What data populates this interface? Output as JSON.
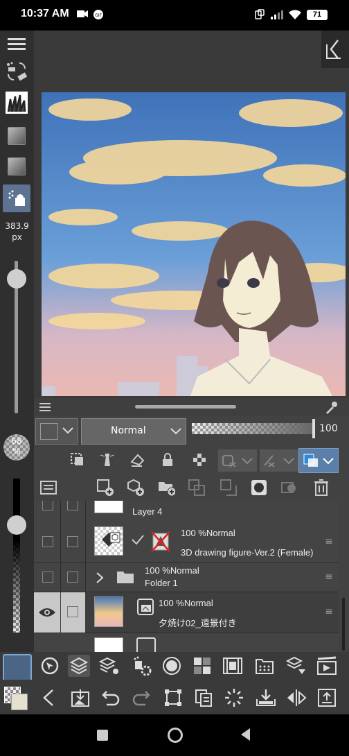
{
  "status_bar": {
    "time": "10:37 AM",
    "battery": "71"
  },
  "left_toolbar": {
    "brush_size_value": "383.9",
    "brush_size_unit": "px",
    "opacity_value": "68",
    "opacity_unit": "%",
    "brush_size_level": 0.12,
    "opacity_level": 0.3
  },
  "palette": {
    "blend_mode": "Normal",
    "opacity_value": "100",
    "layers": [
      {
        "name": "Layer 4",
        "visible": false,
        "selected": false
      },
      {
        "info": "100 %Normal",
        "name": "3D drawing figure-Ver.2 (Female)",
        "visible": false,
        "selected": false
      },
      {
        "info": "100 %Normal",
        "name": "Folder 1",
        "visible": false,
        "selected": false
      },
      {
        "info": "100 %Normal",
        "name": "夕焼け02_遠景付き",
        "visible": true,
        "selected": true
      }
    ]
  },
  "colors": {
    "accent_blue": "#2f88d8",
    "selected_row": "#c8c8c8",
    "sky_top": "#4a78b6",
    "sky_bottom": "#e8b8b4"
  }
}
